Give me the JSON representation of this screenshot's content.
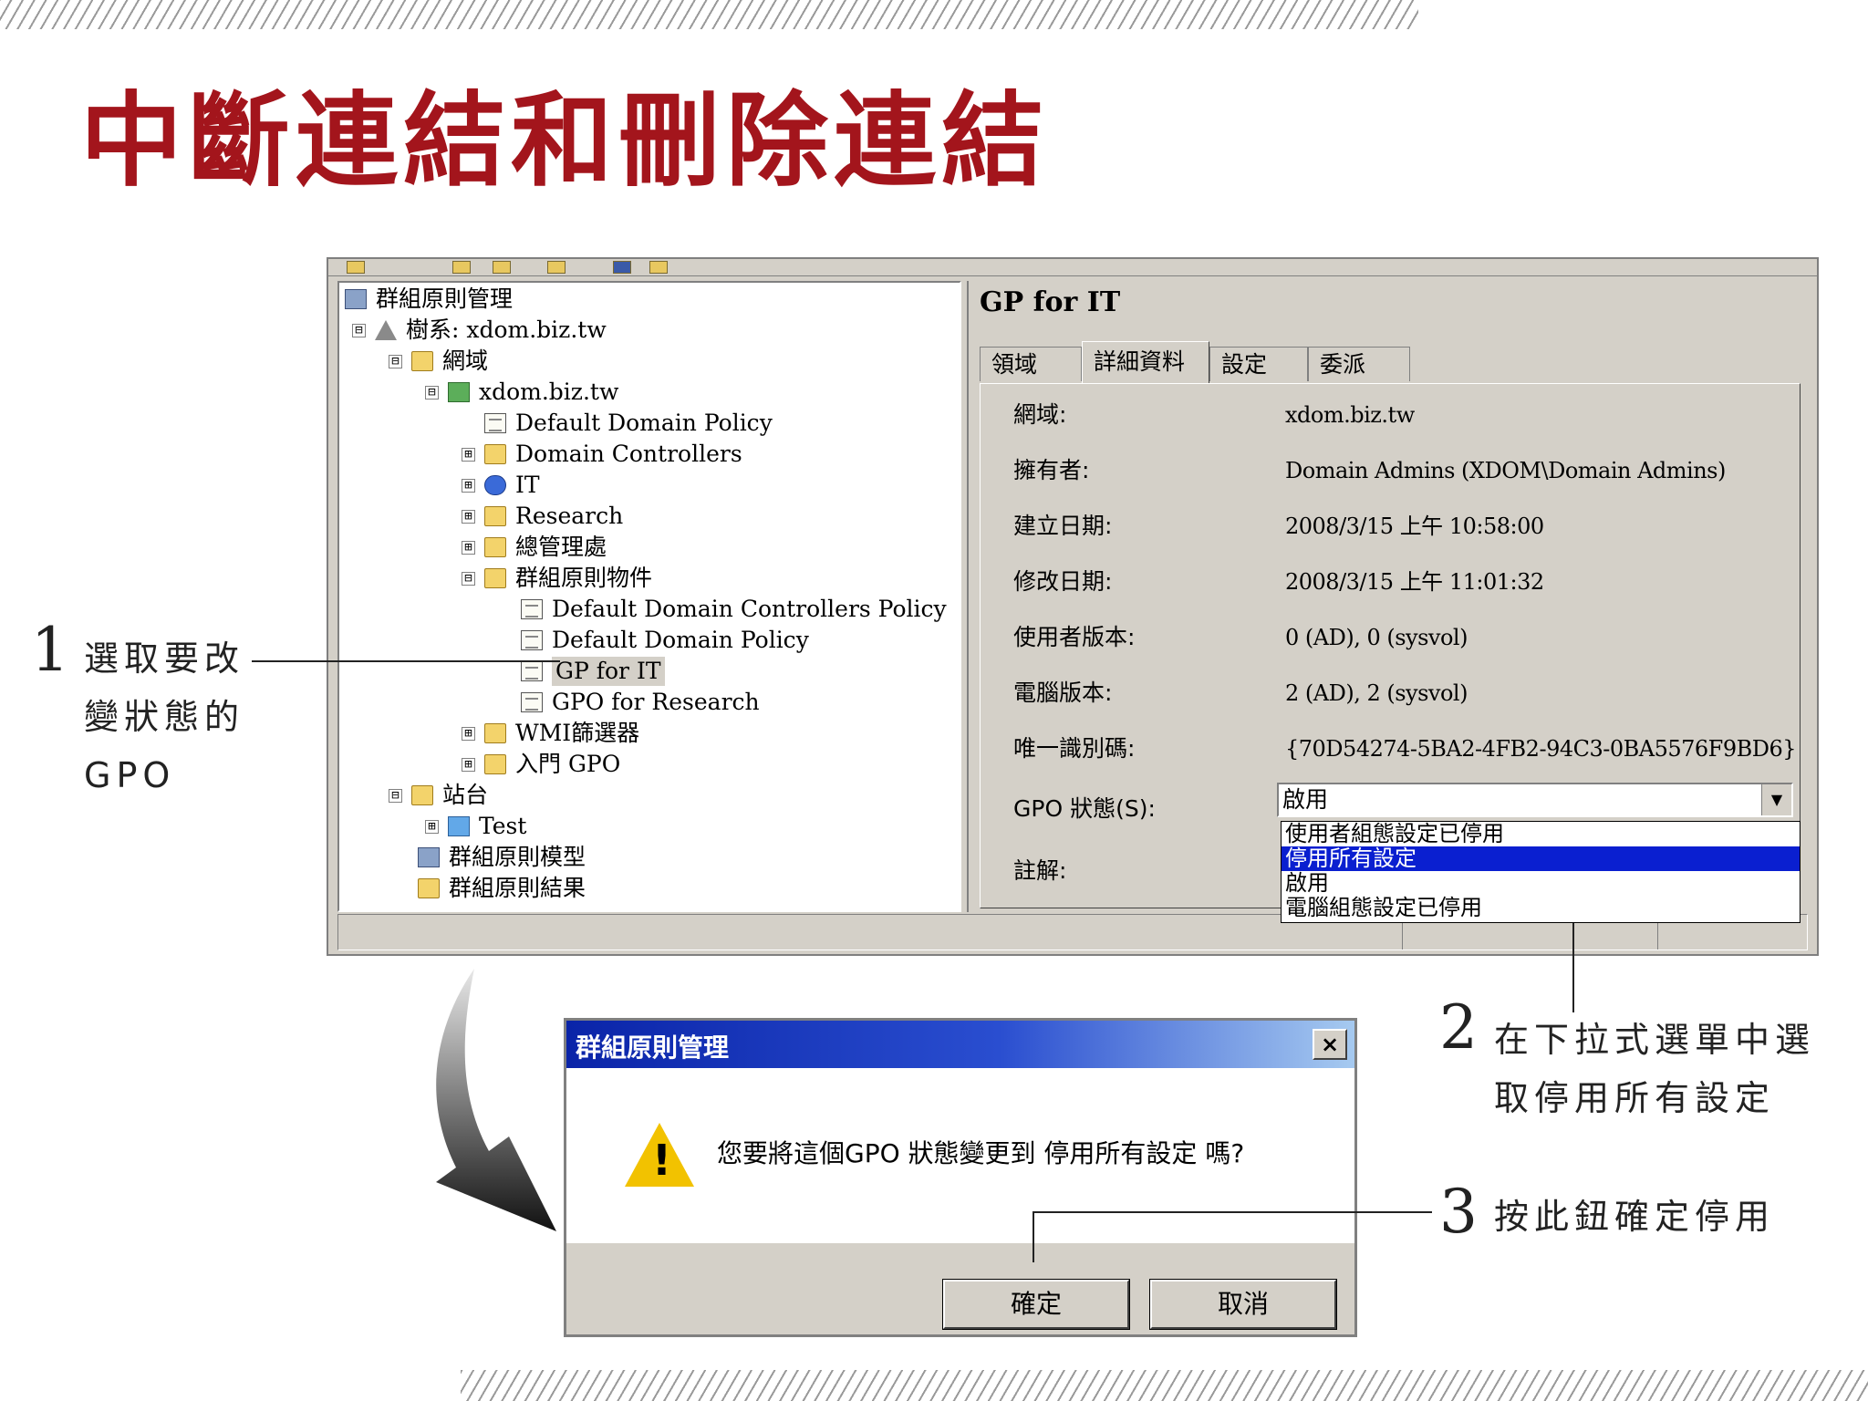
{
  "page": {
    "title": "中斷連結和刪除連結"
  },
  "tree": {
    "items": [
      {
        "label": "群組原則管理",
        "icon": "gpm-console-icon",
        "expander": ""
      },
      {
        "label": "樹系: xdom.biz.tw",
        "icon": "forest-icon",
        "expander": "⊟"
      },
      {
        "label": "網域",
        "icon": "domains-folder-icon",
        "expander": "⊟"
      },
      {
        "label": "xdom.biz.tw",
        "icon": "domain-icon",
        "expander": "⊟"
      },
      {
        "label": "Default Domain Policy",
        "icon": "gpo-link-icon",
        "expander": ""
      },
      {
        "label": "Domain Controllers",
        "icon": "ou-folder-icon",
        "expander": "⊞"
      },
      {
        "label": "IT",
        "icon": "ou-info-icon",
        "expander": "⊞"
      },
      {
        "label": "Research",
        "icon": "ou-folder-icon",
        "expander": "⊞"
      },
      {
        "label": "總管理處",
        "icon": "ou-folder-icon",
        "expander": "⊞"
      },
      {
        "label": "群組原則物件",
        "icon": "gpo-folder-icon",
        "expander": "⊟"
      },
      {
        "label": "Default Domain Controllers Policy",
        "icon": "gpo-icon",
        "expander": ""
      },
      {
        "label": "Default Domain Policy",
        "icon": "gpo-icon",
        "expander": ""
      },
      {
        "label": "GP for IT",
        "icon": "gpo-icon",
        "expander": ""
      },
      {
        "label": "GPO for Research",
        "icon": "gpo-icon",
        "expander": ""
      },
      {
        "label": "WMI篩選器",
        "icon": "wmi-folder-icon",
        "expander": "⊞"
      },
      {
        "label": "入門 GPO",
        "icon": "starter-gpo-icon",
        "expander": "⊞"
      },
      {
        "label": "站台",
        "icon": "sites-folder-icon",
        "expander": "⊟"
      },
      {
        "label": "Test",
        "icon": "site-icon",
        "expander": "⊞"
      },
      {
        "label": "群組原則模型",
        "icon": "modeling-icon",
        "expander": ""
      },
      {
        "label": "群組原則結果",
        "icon": "results-icon",
        "expander": ""
      }
    ]
  },
  "details": {
    "title": "GP for IT",
    "tabs": [
      "領域",
      "詳細資料",
      "設定",
      "委派"
    ],
    "fields": [
      {
        "label": "網域:",
        "value": "xdom.biz.tw"
      },
      {
        "label": "擁有者:",
        "value": "Domain Admins (XDOM\\Domain Admins)"
      },
      {
        "label": "建立日期:",
        "value": "2008/3/15 上午 10:58:00"
      },
      {
        "label": "修改日期:",
        "value": "2008/3/15 上午 11:01:32"
      },
      {
        "label": "使用者版本:",
        "value": "0 (AD), 0 (sysvol)"
      },
      {
        "label": "電腦版本:",
        "value": "2 (AD), 2 (sysvol)"
      },
      {
        "label": "唯一識別碼:",
        "value": "{70D54274-5BA2-4FB2-94C3-0BA5576F9BD6}"
      }
    ],
    "status_label": "GPO 狀態(S):",
    "status_value": "啟用",
    "comment_label": "註解:",
    "dropdown_options": [
      "使用者組態設定已停用",
      "停用所有設定",
      "啟用",
      "電腦組態設定已停用"
    ]
  },
  "dialog": {
    "title": "群組原則管理",
    "message": "您要將這個GPO 狀態變更到 停用所有設定 嗎?",
    "ok_label": "確定",
    "cancel_label": "取消",
    "close_glyph": "×",
    "warn_glyph": "!"
  },
  "annotations": {
    "step1": {
      "num": "1",
      "line1": "選取要改",
      "line2": "變狀態的",
      "line3": "GPO"
    },
    "step2": {
      "num": "2",
      "line1": "在下拉式選單中選",
      "line2": "取停用所有設定"
    },
    "step3": {
      "num": "3",
      "line1": "按此鈕確定停用"
    }
  },
  "colors": {
    "title": "#a3151c",
    "highlight": "#0a1fd0",
    "dialog_title_start": "#0a24a8"
  }
}
